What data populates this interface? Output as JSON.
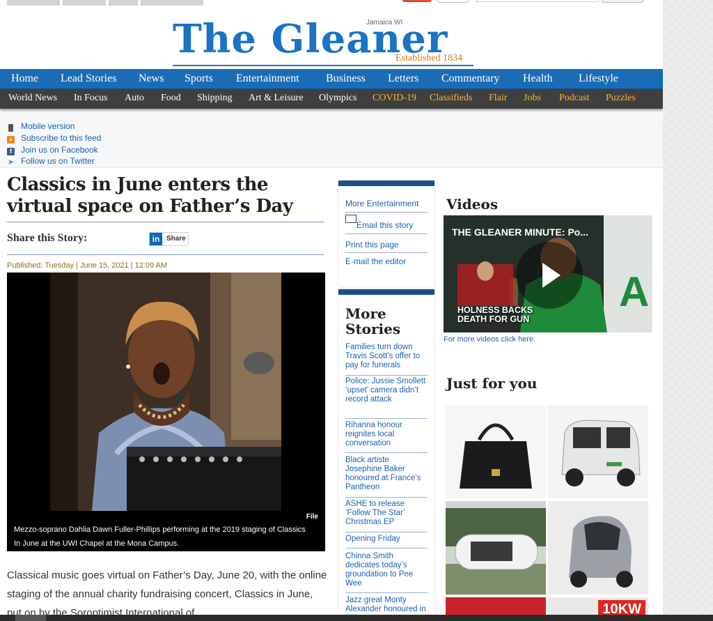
{
  "masthead": {
    "name": "The Gleaner",
    "location": "Jamaica WI",
    "established": "Established 1834"
  },
  "nav_primary": [
    "Home",
    "Lead Stories",
    "News",
    "Sports",
    "Entertainment",
    "Business",
    "Letters",
    "Commentary",
    "Health",
    "Lifestyle"
  ],
  "nav_secondary": [
    {
      "label": "World News",
      "highlight": false
    },
    {
      "label": "In Focus",
      "highlight": false
    },
    {
      "label": "Auto",
      "highlight": false
    },
    {
      "label": "Food",
      "highlight": false
    },
    {
      "label": "Shipping",
      "highlight": false
    },
    {
      "label": "Art & Leisure",
      "highlight": false
    },
    {
      "label": "Olympics",
      "highlight": false
    },
    {
      "label": "COVID-19",
      "highlight": true
    },
    {
      "label": "Classifieds",
      "highlight": true
    },
    {
      "label": "Flair",
      "highlight": true
    },
    {
      "label": "Jobs",
      "highlight": true
    },
    {
      "label": "Podcast",
      "highlight": true
    },
    {
      "label": "Puzzles",
      "highlight": true
    }
  ],
  "utility_links": [
    {
      "label": "Mobile version",
      "icon": "mobile-icon"
    },
    {
      "label": "Subscribe to this feed",
      "icon": "rss-icon"
    },
    {
      "label": "Join us on Facebook",
      "icon": "facebook-icon"
    },
    {
      "label": "Follow us on Twitter",
      "icon": "twitter-icon"
    }
  ],
  "article": {
    "headline": "Classics in June enters the virtual space on Father’s Day",
    "share_label": "Share this Story:",
    "share_button": "Share",
    "published": "Published: Tuesday | June 15, 2021 | 12:09 AM",
    "photo_credit": "File",
    "photo_caption": "Mezzo-soprano Dahlia Dawn Fuller-Phillips performing at the 2019 staging of Classics In June at the UWI Chapel at the Mona Campus.",
    "body": "Classical music goes virtual on Father’s Day, June 20, with the online staging of the annual charity fundraising concert, Classics in June, put on by the Soroptimist International of"
  },
  "article_tools": {
    "more_entertainment": "More Entertainment",
    "email_story": "Email this story",
    "print_page": "Print this page",
    "email_editor": "E-mail the editor"
  },
  "more_stories": {
    "title": "More Stories",
    "items": [
      "Families turn down Travis Scott’s offer to pay for funerals",
      "Police: Jussie Smollett ‘upset’ camera didn’t record attack",
      "Rihanna honour reignites local conversation",
      "Black artiste Josephine Baker honoured at France’s Pantheon",
      "ASHE to release ‘Follow The Star’ Christmas EP",
      "Opening Friday",
      "Chinna Smith dedicates today’s groundation to Pee Wee",
      "Jazz great Monty Alexander honoured in NY"
    ]
  },
  "videos": {
    "title": "Videos",
    "video_title": "THE GLEANER MINUTE: Po...",
    "video_caption_line1": "HOLNESS BACKS",
    "video_caption_line2": "DEATH FOR GUN",
    "more_link": "For more videos click here."
  },
  "just_for_you": {
    "title": "Just for you",
    "ad_badge": "10KW"
  },
  "colors": {
    "brand_blue": "#1a73c4",
    "nav_blue": "#1b6cb6",
    "nav_dark": "#3f3f3f",
    "nav_highlight": "#f3b63b",
    "link": "#1a5fb4"
  }
}
